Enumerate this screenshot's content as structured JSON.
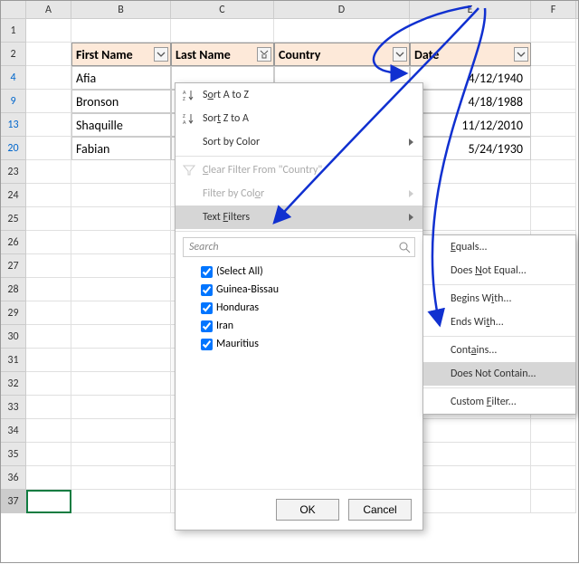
{
  "columns": {
    "A": "A",
    "B": "B",
    "C": "C",
    "D": "D",
    "E": "E",
    "F": "F"
  },
  "row_labels": {
    "r1": "1",
    "r2": "2",
    "r4": "4",
    "r9": "9",
    "r13": "13",
    "r20": "20",
    "r23": "23",
    "r24": "24",
    "r25": "25",
    "r26": "26",
    "r27": "27",
    "r28": "28",
    "r29": "29",
    "r30": "30",
    "r31": "31",
    "r32": "32",
    "r33": "33",
    "r34": "34",
    "r35": "35",
    "r36": "36",
    "r37": "37"
  },
  "headers": {
    "first": "First Name",
    "last": "Last Name",
    "country": "Country",
    "date": "Date"
  },
  "rows": [
    {
      "first": "Afia",
      "last": "",
      "date": "4/12/1940"
    },
    {
      "first": "Bronson",
      "last": "",
      "date": "4/18/1988"
    },
    {
      "first": "Shaquille",
      "last": "",
      "date": "11/12/2010"
    },
    {
      "first": "Fabian",
      "last": "",
      "date": "5/24/1930"
    }
  ],
  "menu": {
    "sort_az": "Sort A to Z",
    "sort_za": "Sort Z to A",
    "sort_color": "Sort by Color",
    "clear_filter": "Clear Filter From \"Country\"",
    "filter_color": "Filter by Color",
    "text_filters": "Text Filters",
    "search_placeholder": "Search",
    "items": {
      "all": "(Select All)",
      "i1": "Guinea-Bissau",
      "i2": "Honduras",
      "i3": "Iran",
      "i4": "Mauritius"
    },
    "ok": "OK",
    "cancel": "Cancel"
  },
  "submenu": {
    "equals": "Equals...",
    "not_equal": "Does Not Equal...",
    "begins": "Begins With...",
    "ends": "Ends With...",
    "contains": "Contains...",
    "not_contain": "Does Not Contain...",
    "custom": "Custom Filter..."
  }
}
